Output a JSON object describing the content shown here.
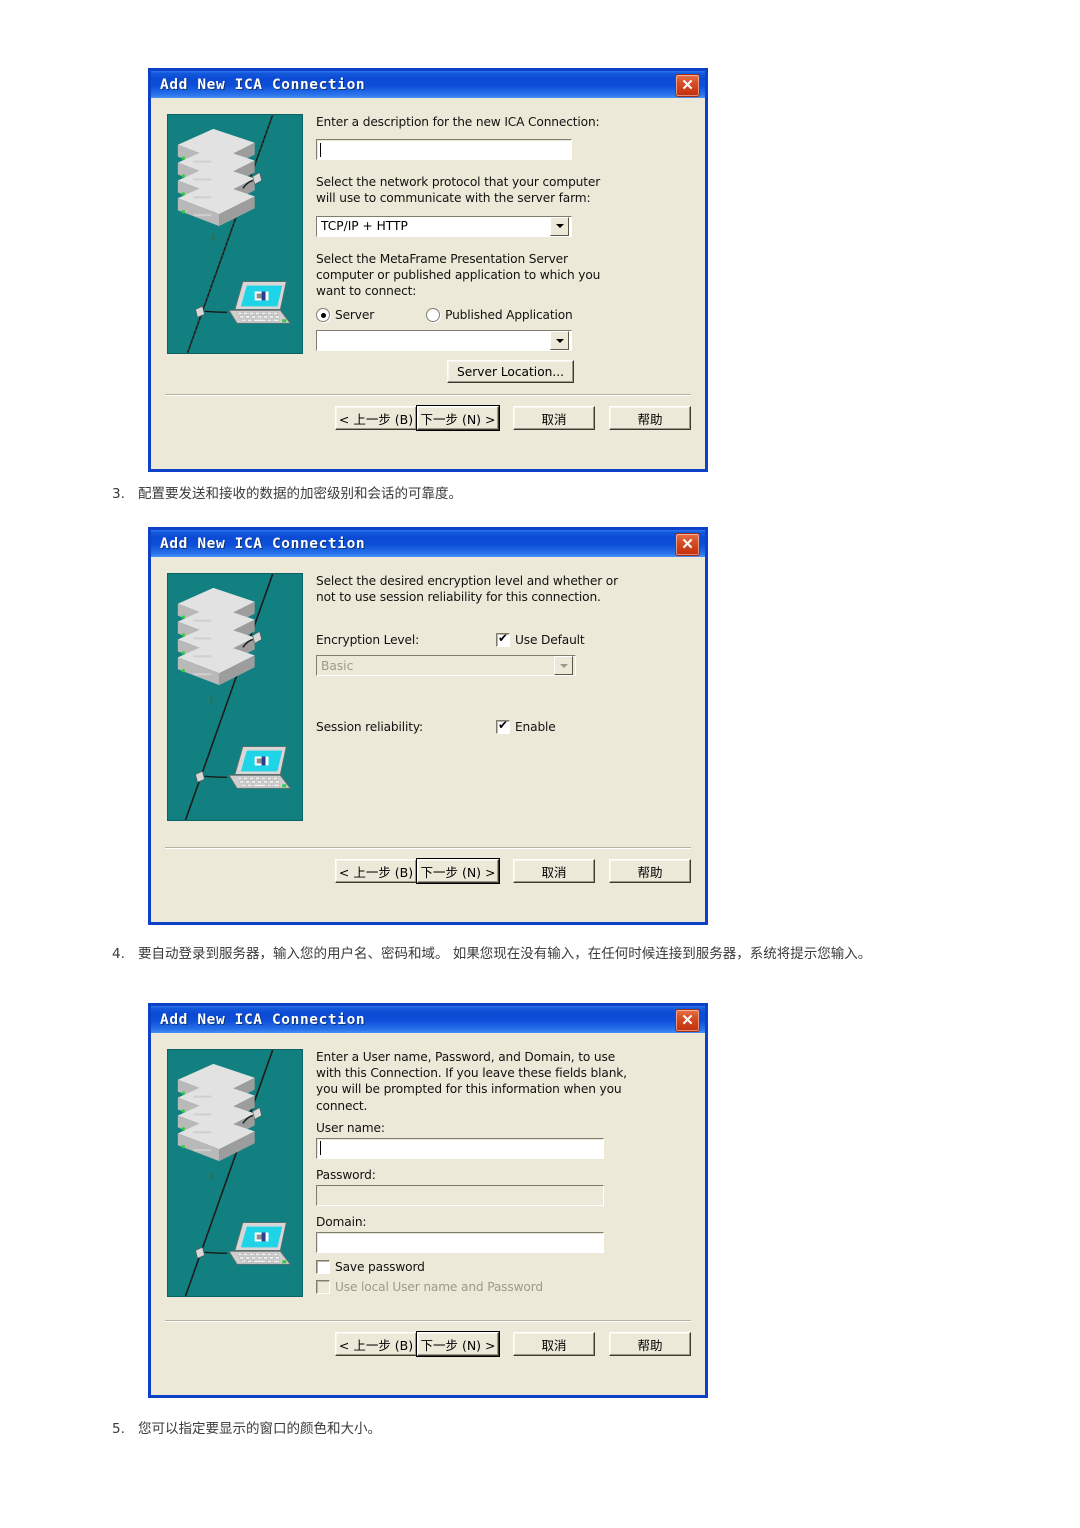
{
  "document": {
    "steps": [
      {
        "num": "3.",
        "text": "配置要发送和接收的数据的加密级别和会话的可靠度。"
      },
      {
        "num": "4.",
        "text": "要自动登录到服务器，输入您的用户名、密码和域。 如果您现在没有输入，在任何时候连接到服务器，系统将提示您输入。"
      },
      {
        "num": "5.",
        "text": "您可以指定要显示的窗口的颜色和大小。"
      }
    ]
  },
  "common": {
    "window_title": "Add New ICA Connection",
    "close_glyph": "✕",
    "buttons": {
      "back": "< 上一步 (B)",
      "next": "下一步 (N) >",
      "cancel": "取消",
      "help": "帮助"
    }
  },
  "dialog1": {
    "title": "Add New ICA Connection",
    "description_label": "Enter a description for the new ICA Connection:",
    "description_value": "",
    "protocol_label": "Select the network protocol that your computer will use to communicate with the server farm:",
    "protocol_value": "TCP/IP + HTTP",
    "target_label": "Select the MetaFrame Presentation Server computer or published application to which you want to connect:",
    "radio_server": "Server",
    "radio_published": "Published Application",
    "server_value": "",
    "server_location_button": "Server Location..."
  },
  "dialog2": {
    "title": "Add New ICA Connection",
    "description": "Select the desired encryption level and whether or not to use session reliability for this connection.",
    "encryption_label": "Encryption Level:",
    "use_default_label": "Use Default",
    "encryption_value": "Basic",
    "session_label": "Session reliability:",
    "enable_label": "Enable"
  },
  "dialog3": {
    "title": "Add New ICA Connection",
    "description": "Enter a User name, Password, and Domain, to use with this Connection.  If you leave these fields blank, you will be prompted for this information when you connect.",
    "username_label": "User name:",
    "username_value": "",
    "password_label": "Password:",
    "password_value": "",
    "domain_label": "Domain:",
    "domain_value": "",
    "save_password_label": "Save password",
    "use_local_label": "Use local User name and Password"
  },
  "colors": {
    "title_blue": "#0d42c8",
    "dialog_face": "#ece9d8",
    "illustration_teal": "#128080",
    "close_red": "#c32e0c"
  }
}
